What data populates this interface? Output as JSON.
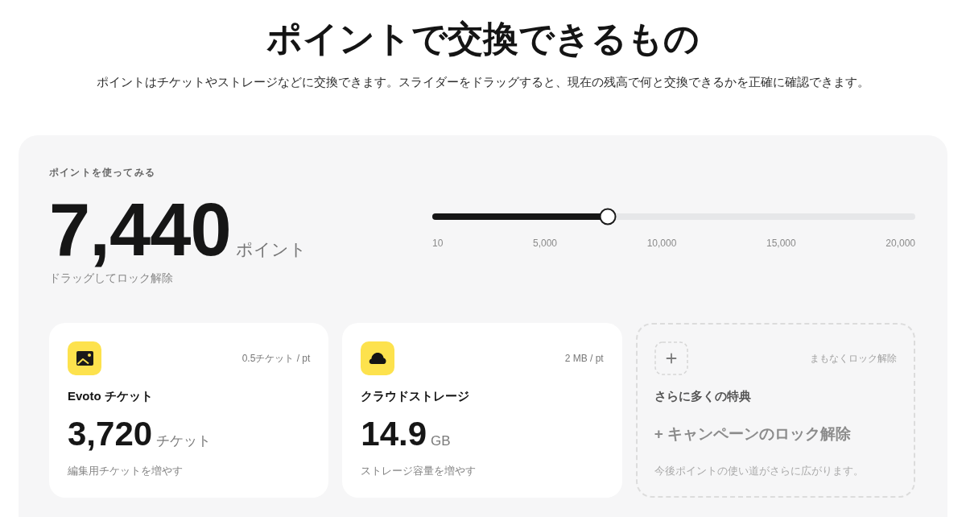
{
  "header": {
    "title": "ポイントで交換できるもの",
    "subtitle": "ポイントはチケットやストレージなどに交換できます。スライダーをドラッグすると、現在の残高で何と交換できるかを正確に確認できます。"
  },
  "calculator": {
    "label": "ポイントを使ってみる",
    "points": "7,440",
    "unit": "ポイント",
    "hint": "ドラッグしてロック解除",
    "slider": {
      "level": 0.364,
      "ticks": [
        "10",
        "5,000",
        "10,000",
        "15,000",
        "20,000"
      ]
    }
  },
  "rewards": [
    {
      "kind": "ticket",
      "rate": "0.5チケット / pt",
      "title": "Evoto チケット",
      "amount": "3,720",
      "unit": "チケット",
      "description": "編集用チケットを増やす"
    },
    {
      "kind": "storage",
      "rate": "2 MB / pt",
      "title": "クラウドストレージ",
      "amount": "14.9",
      "unit": "GB",
      "description": "ストレージ容量を増やす"
    },
    {
      "kind": "upcoming",
      "status": "まもなくロック解除",
      "title": "さらに多くの特典",
      "headline": "+ キャンペーンのロック解除",
      "description": "今後ポイントの使い道がさらに広がります。"
    }
  ]
}
